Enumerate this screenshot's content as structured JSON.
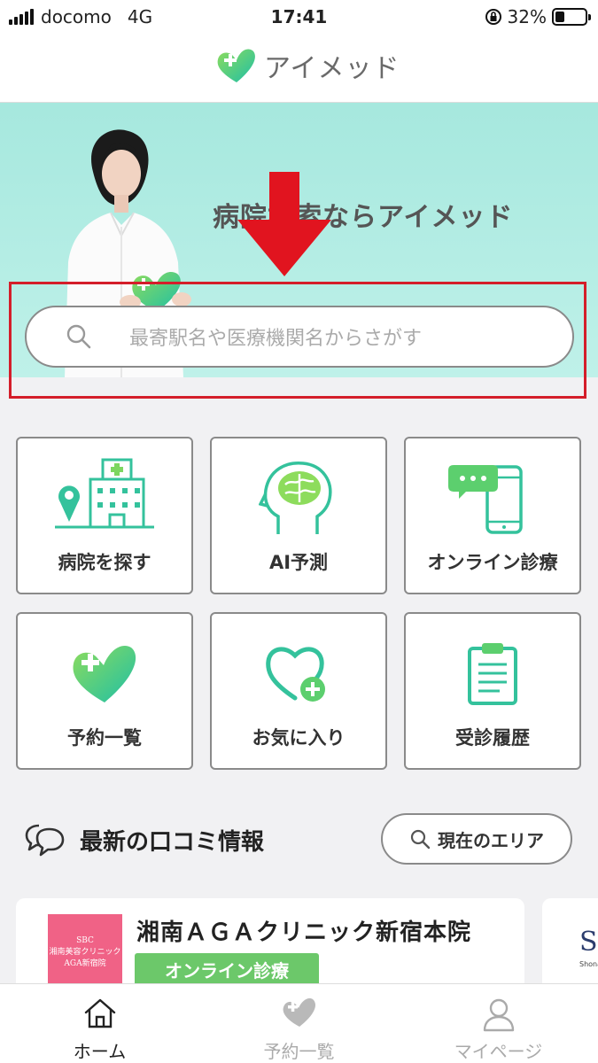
{
  "status_bar": {
    "carrier": "docomo",
    "network": "4G",
    "time": "17:41",
    "battery": "32%",
    "battery_level": 0.32
  },
  "app": {
    "name": "アイメッド",
    "brand_color_light": "#7bd66b",
    "brand_color_dark": "#21c0a8"
  },
  "hero": {
    "tagline": "病院検索ならアイメッド",
    "search_placeholder": "最寄駅名や医療機関名からさがす"
  },
  "menu": [
    {
      "label": "病院を探す",
      "icon": "hospital-search-icon"
    },
    {
      "label": "AI予測",
      "icon": "ai-brain-icon"
    },
    {
      "label": "オンライン診療",
      "icon": "online-chat-phone-icon"
    },
    {
      "label": "予約一覧",
      "icon": "heart-logo-icon"
    },
    {
      "label": "お気に入り",
      "icon": "heart-plus-icon"
    },
    {
      "label": "受診履歴",
      "icon": "clipboard-icon"
    }
  ],
  "reviews": {
    "title": "最新の口コミ情報",
    "area_button": "現在のエリア"
  },
  "cards": [
    {
      "name": "湘南ＡＧＡクリニック新宿本院",
      "badge": "オンライン診療",
      "logo_lines": [
        "SBC",
        "湘南美容クリニック",
        "AGA新宿院"
      ]
    },
    {
      "logo_text": "SI",
      "logo_sub": "Shona"
    }
  ],
  "tabbar": [
    {
      "label": "ホーム",
      "icon": "home-icon",
      "active": true
    },
    {
      "label": "予約一覧",
      "icon": "heart-logo-icon",
      "active": false
    },
    {
      "label": "マイページ",
      "icon": "person-icon",
      "active": false
    }
  ]
}
